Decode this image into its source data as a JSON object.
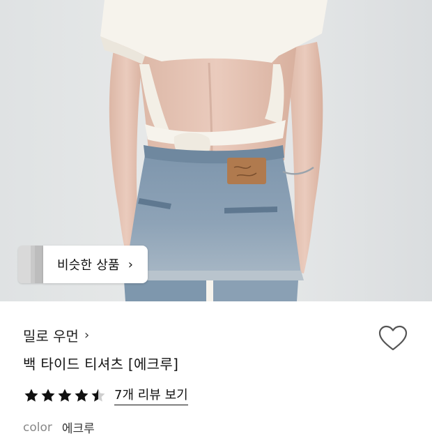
{
  "photo": {
    "alt": "product-photo",
    "similar_button": {
      "label": "비슷한 상품",
      "chevron": "›"
    }
  },
  "product": {
    "brand": "밀로 우먼",
    "brand_chevron": "›",
    "title": "백 타이드 티셔츠 [에크루]",
    "rating": 4.5,
    "rating_max": 5,
    "review_link": "7개 리뷰 보기",
    "color_label": "color",
    "color_value": "에크루",
    "wishlist_icon": "heart-outline-icon"
  },
  "colors": {
    "text_primary": "#111111",
    "text_muted": "#888888",
    "star": "#111111",
    "background": "#ffffff"
  }
}
